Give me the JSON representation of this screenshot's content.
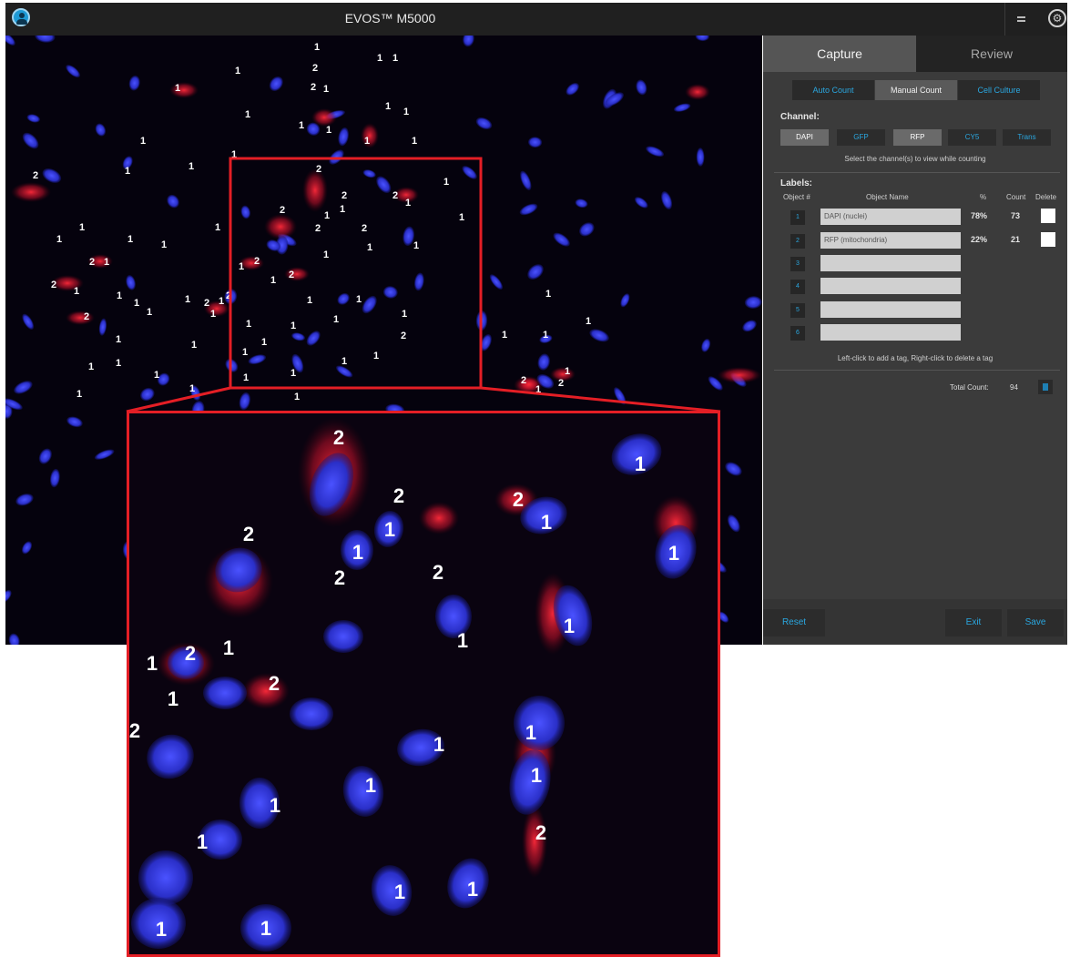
{
  "window": {
    "title": "EVOS™ M5000"
  },
  "icons": {
    "user": "user-circle-icon",
    "menu": "menu-icon",
    "settings": "gear-icon"
  },
  "tabs": {
    "capture": "Capture",
    "review": "Review"
  },
  "modes": {
    "auto": "Auto Count",
    "manual": "Manual Count",
    "cell": "Cell Culture"
  },
  "channel": {
    "heading": "Channel:",
    "buttons": [
      "DAPI",
      "GFP",
      "RFP",
      "CY5",
      "Trans"
    ],
    "hint": "Select the channel(s) to view while counting"
  },
  "labels": {
    "heading": "Labels:",
    "columns": {
      "object": "Object #",
      "name": "Object Name",
      "pct": "%",
      "count": "Count",
      "delete": "Delete"
    },
    "rows": [
      {
        "num": "1",
        "name": "DAPI (nuclei)",
        "pct": "78%",
        "count": "73"
      },
      {
        "num": "2",
        "name": "RFP (mitochondria)",
        "pct": "22%",
        "count": "21"
      },
      {
        "num": "3",
        "name": "",
        "pct": "",
        "count": ""
      },
      {
        "num": "4",
        "name": "",
        "pct": "",
        "count": ""
      },
      {
        "num": "5",
        "name": "",
        "pct": "",
        "count": ""
      },
      {
        "num": "6",
        "name": "",
        "pct": "",
        "count": ""
      }
    ],
    "hint": "Left-click to add a tag, Right-click to delete a tag"
  },
  "total": {
    "label": "Total Count:",
    "value": "94"
  },
  "footer": {
    "reset": "Reset",
    "exit": "Exit",
    "save": "Save"
  },
  "colors": {
    "accent": "#2aa7e0",
    "callout": "#e41e25"
  },
  "image_tags": {
    "nucleus": "1",
    "mitochondria": "2"
  }
}
